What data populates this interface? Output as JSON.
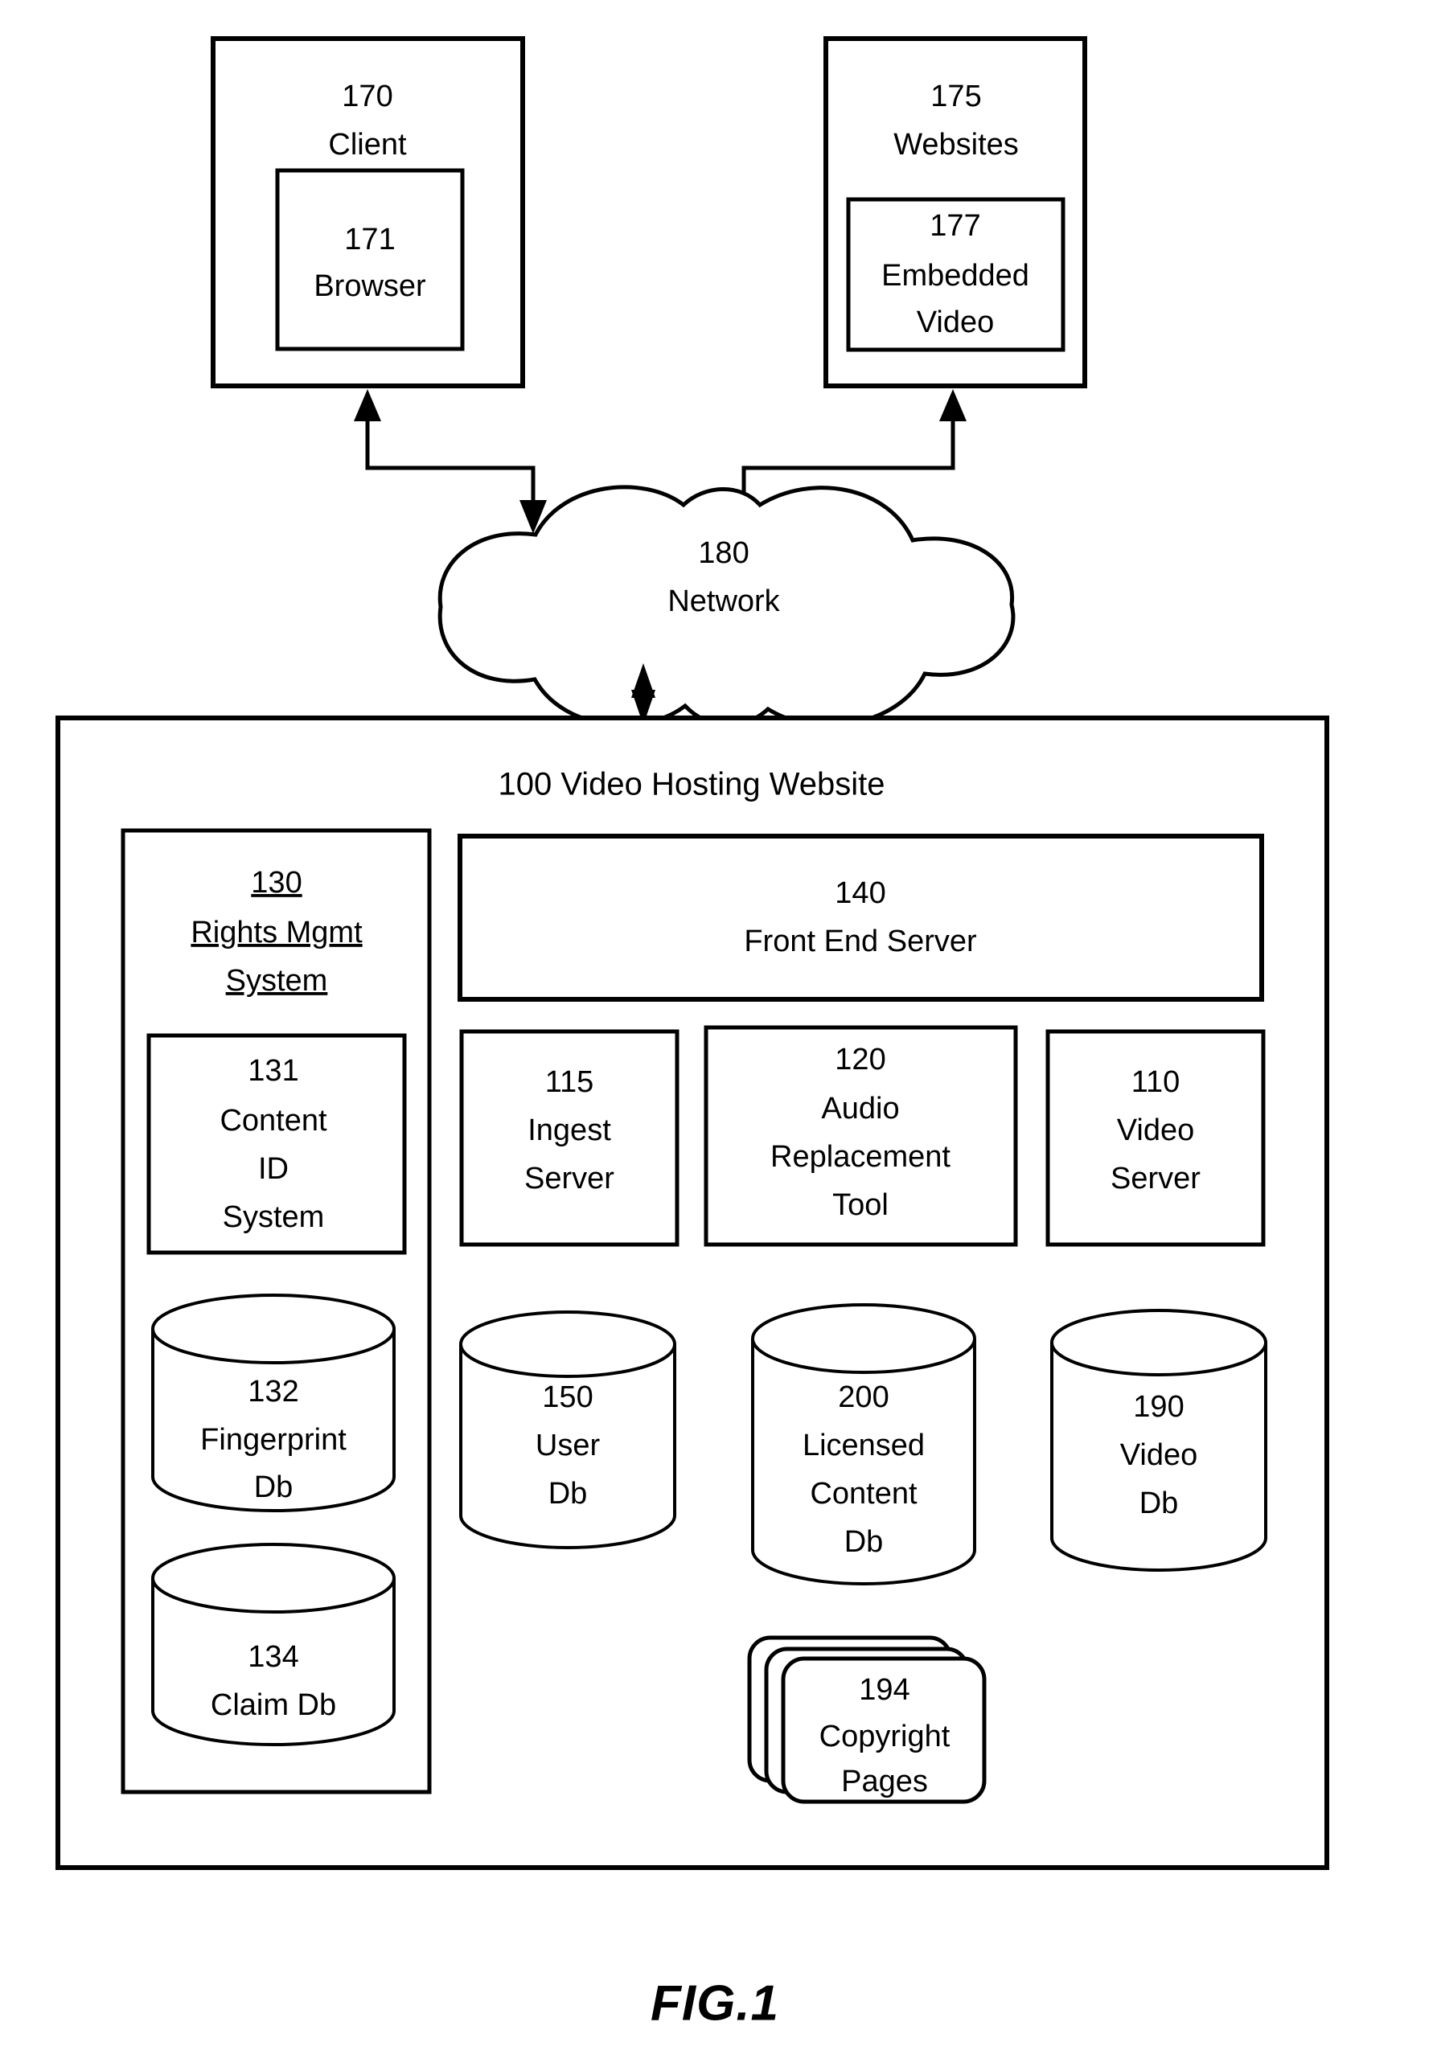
{
  "figure": {
    "caption": "FIG.1",
    "title": "100 Video Hosting Website"
  },
  "top_nodes": {
    "client": {
      "ref": "170",
      "label": "Client",
      "child": {
        "ref": "171",
        "label": "Browser"
      }
    },
    "websites": {
      "ref": "175",
      "label": "Websites",
      "child": {
        "ref": "177",
        "label_line1": "Embedded",
        "label_line2": "Video"
      }
    }
  },
  "network": {
    "ref": "180",
    "label": "Network"
  },
  "rights_mgmt_system": {
    "ref": "130",
    "label_line1": "Rights Mgmt",
    "label_line2": "System",
    "content_id_system": {
      "ref": "131",
      "line1": "Content",
      "line2": "ID",
      "line3": "System"
    },
    "fingerprint_db": {
      "ref": "132",
      "line1": "Fingerprint",
      "line2": "Db"
    },
    "claim_db": {
      "ref": "134",
      "line1": "Claim Db"
    }
  },
  "servers": {
    "front_end_server": {
      "ref": "140",
      "label": "Front End Server"
    },
    "ingest_server": {
      "ref": "115",
      "line1": "Ingest",
      "line2": "Server"
    },
    "audio_replacement_tool": {
      "ref": "120",
      "line1": "Audio",
      "line2": "Replacement",
      "line3": "Tool"
    },
    "video_server": {
      "ref": "110",
      "line1": "Video",
      "line2": "Server"
    }
  },
  "databases": {
    "user_db": {
      "ref": "150",
      "line1": "User",
      "line2": "Db"
    },
    "licensed_content_db": {
      "ref": "200",
      "line1": "Licensed",
      "line2": "Content",
      "line3": "Db"
    },
    "video_db": {
      "ref": "190",
      "line1": "Video",
      "line2": "Db"
    }
  },
  "copyright_pages": {
    "ref": "194",
    "line1": "Copyright",
    "line2": "Pages"
  },
  "colors": {
    "stroke": "#000000",
    "fill": "#ffffff",
    "text": "#000000"
  }
}
